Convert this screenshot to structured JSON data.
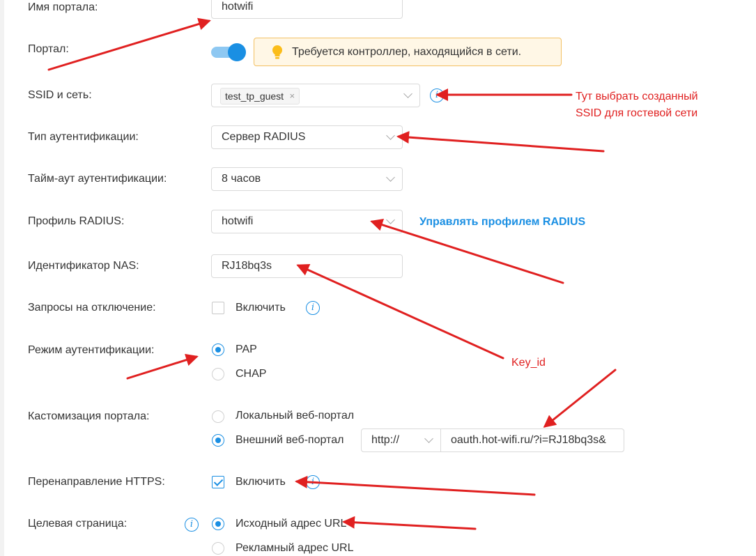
{
  "portal_name": {
    "label": "Имя портала:",
    "value": "hotwifi"
  },
  "portal": {
    "label": "Портал:",
    "toggle_state": "on",
    "notice": "Требуется контроллер, находящийся в сети."
  },
  "ssid": {
    "label": "SSID и сеть:",
    "tag": "test_tp_guest",
    "tag_remove": "×"
  },
  "auth_type": {
    "label": "Тип аутентификации:",
    "value": "Сервер RADIUS"
  },
  "auth_timeout": {
    "label": "Тайм-аут аутентификации:",
    "value": "8 часов"
  },
  "radius_profile": {
    "label": "Профиль RADIUS:",
    "value": "hotwifi",
    "manage_link": "Управлять профилем RADIUS"
  },
  "nas_id": {
    "label": "Идентификатор NAS:",
    "value": "RJ18bq3s"
  },
  "disconnect_requests": {
    "label": "Запросы на отключение:",
    "checkbox_label": "Включить",
    "checked": false
  },
  "auth_mode": {
    "label": "Режим аутентификации:",
    "options": [
      "PAP",
      "CHAP"
    ],
    "selected": "PAP"
  },
  "portal_customization": {
    "label": "Кастомизация портала:",
    "options": [
      "Локальный веб-портал",
      "Внешний веб-портал"
    ],
    "selected": "Внешний веб-портал",
    "protocol": "http://",
    "url": "oauth.hot-wifi.ru/?i=RJ18bq3s&"
  },
  "https_redirect": {
    "label": "Перенаправление HTTPS:",
    "checkbox_label": "Включить",
    "checked": true
  },
  "landing_page": {
    "label": "Целевая страница:",
    "options": [
      "Исходный адрес URL",
      "Рекламный адрес URL"
    ],
    "selected": "Исходный адрес URL"
  },
  "annotations": {
    "ssid_note_line1": "Тут выбрать созданный",
    "ssid_note_line2": "SSID для гостевой сети",
    "key_note": "Key_id"
  },
  "colors": {
    "accent": "#1a8fe3",
    "arrow": "#e02020",
    "notice_bg": "#fff7e6",
    "notice_border": "#f3c062"
  },
  "icons": [
    "lightbulb-icon",
    "info-icon",
    "chevron-down-icon",
    "close-icon"
  ]
}
